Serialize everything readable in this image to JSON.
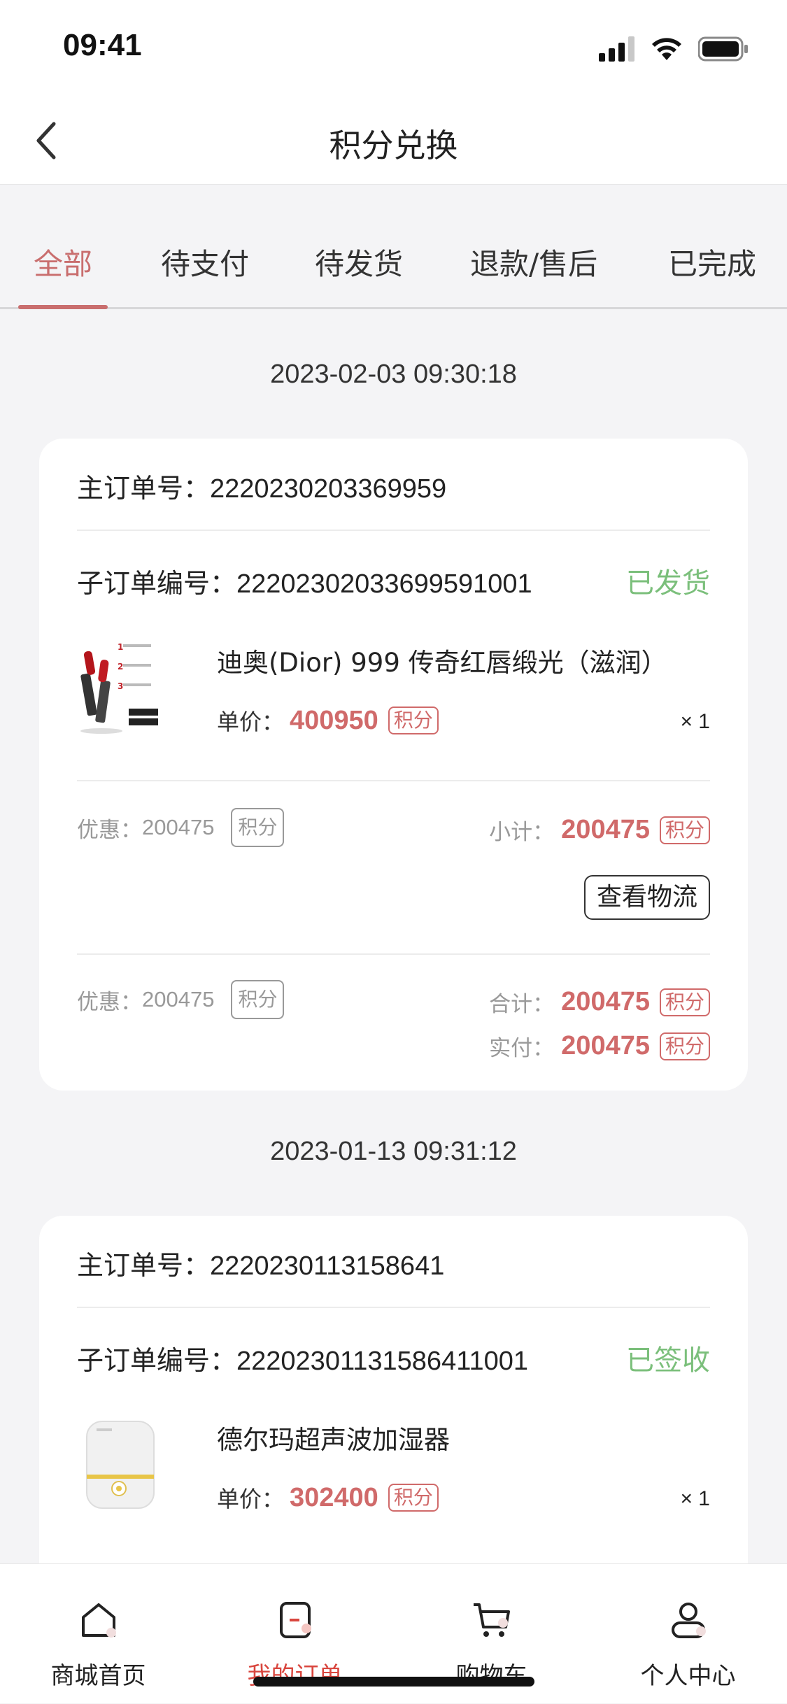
{
  "status_bar": {
    "time": "09:41"
  },
  "header": {
    "title": "积分兑换"
  },
  "tabs": [
    {
      "label": "全部",
      "active": true
    },
    {
      "label": "待支付"
    },
    {
      "label": "待发货"
    },
    {
      "label": "退款/售后"
    },
    {
      "label": "已完成"
    }
  ],
  "orders": [
    {
      "date": "2023-02-03 09:30:18",
      "main_order_label": "主订单号：",
      "main_order_no": "2220230203369959",
      "sub_order_label": "子订单编号：",
      "sub_order_no": "22202302033699591001",
      "status": "已发货",
      "product_name": "迪奥(Dior) 999 传奇红唇缎光（滋润）",
      "unit_price_label": "单价：",
      "unit_price": "400950",
      "points_tag": "积分",
      "qty": "× 1",
      "discount_label": "优惠：",
      "discount_value": "200475",
      "subtotal_label": "小计：",
      "subtotal": "200475",
      "logistics_button": "查看物流",
      "summary_discount_label": "优惠：",
      "summary_discount_value": "200475",
      "total_label": "合计：",
      "total": "200475",
      "paid_label": "实付：",
      "paid": "200475"
    },
    {
      "date": "2023-01-13 09:31:12",
      "main_order_label": "主订单号：",
      "main_order_no": "2220230113158641",
      "sub_order_label": "子订单编号：",
      "sub_order_no": "22202301131586411001",
      "status": "已签收",
      "product_name": "德尔玛超声波加湿器",
      "unit_price_label": "单价：",
      "unit_price": "302400",
      "points_tag": "积分",
      "qty": "× 1"
    }
  ],
  "bottom_nav": [
    {
      "label": "商城首页",
      "icon": "home-icon"
    },
    {
      "label": "我的订单",
      "icon": "order-icon",
      "active": true
    },
    {
      "label": "购物车",
      "icon": "cart-icon"
    },
    {
      "label": "个人中心",
      "icon": "user-icon"
    }
  ],
  "colors": {
    "accent": "#c96e6e",
    "status_green": "#7bbf7b",
    "price_red": "#d06a6a",
    "nav_active": "#d9463e"
  }
}
